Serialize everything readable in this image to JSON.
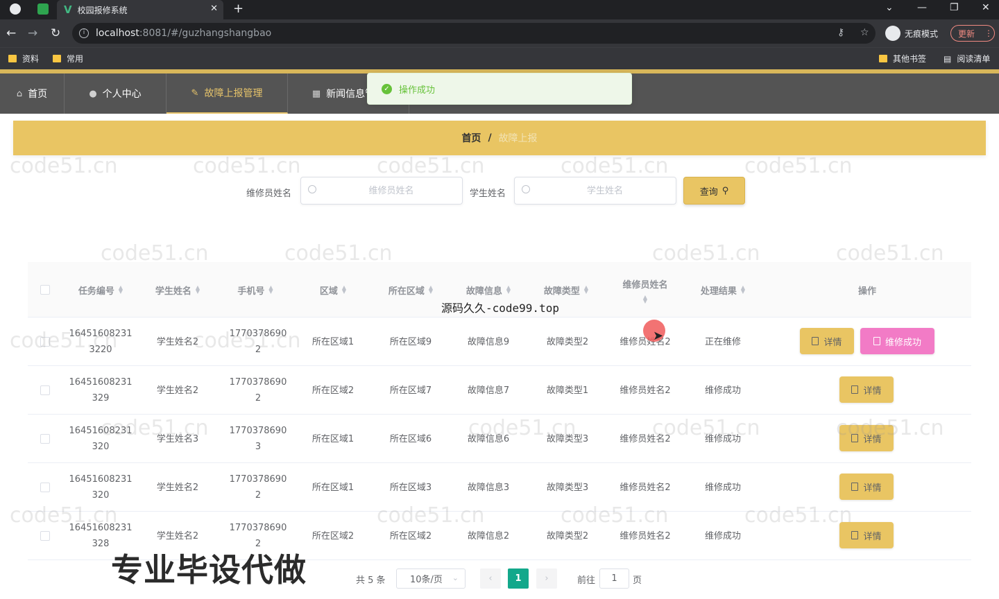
{
  "browser": {
    "tab_title": "校园报修系统",
    "tab_logo": "V",
    "url_host": "localhost",
    "url_path": ":8081/#/guzhangshangbao",
    "incognito_label": "无痕模式",
    "update_label": "更新",
    "bookmarks": [
      "资料",
      "常用"
    ],
    "other_bookmarks": "其他书签",
    "reading_list": "阅读清单"
  },
  "nav": {
    "items": [
      {
        "label": "首页",
        "icon": "home-icon"
      },
      {
        "label": "个人中心",
        "icon": "user-icon"
      },
      {
        "label": "故障上报管理",
        "icon": "edit-icon",
        "active": true
      },
      {
        "label": "新闻信息管理",
        "icon": "news-icon"
      }
    ]
  },
  "toast": {
    "message": "操作成功",
    "color": "#67c23a"
  },
  "breadcrumb": {
    "home": "首页",
    "separator": "/",
    "current": "故障上报"
  },
  "search": {
    "repairer_label": "维修员姓名",
    "repairer_placeholder": "维修员姓名",
    "student_label": "学生姓名",
    "student_placeholder": "学生姓名",
    "query_button": "查询"
  },
  "table": {
    "columns": [
      "任务编号",
      "学生姓名",
      "手机号",
      "区域",
      "所在区域",
      "故障信息",
      "故障类型",
      "维修员姓名",
      "处理结果",
      "操作"
    ],
    "rows": [
      {
        "task_no_1": "16451608231",
        "task_no_2": "3220",
        "student": "学生姓名2",
        "phone_1": "1770378690",
        "phone_2": "2",
        "area": "所在区域1",
        "location": "所在区域9",
        "fault_info": "故障信息9",
        "fault_type": "故障类型2",
        "repairer": "维修员姓名2",
        "result": "正在维修",
        "actions": [
          "详情",
          "维修成功"
        ]
      },
      {
        "task_no_1": "16451608231",
        "task_no_2": "329",
        "student": "学生姓名2",
        "phone_1": "1770378690",
        "phone_2": "2",
        "area": "所在区域2",
        "location": "所在区域7",
        "fault_info": "故障信息7",
        "fault_type": "故障类型1",
        "repairer": "维修员姓名2",
        "result": "维修成功",
        "actions": [
          "详情"
        ]
      },
      {
        "task_no_1": "16451608231",
        "task_no_2": "320",
        "student": "学生姓名3",
        "phone_1": "1770378690",
        "phone_2": "3",
        "area": "所在区域1",
        "location": "所在区域6",
        "fault_info": "故障信息6",
        "fault_type": "故障类型3",
        "repairer": "维修员姓名2",
        "result": "维修成功",
        "actions": [
          "详情"
        ]
      },
      {
        "task_no_1": "16451608231",
        "task_no_2": "320",
        "student": "学生姓名2",
        "phone_1": "1770378690",
        "phone_2": "2",
        "area": "所在区域1",
        "location": "所在区域3",
        "fault_info": "故障信息3",
        "fault_type": "故障类型3",
        "repairer": "维修员姓名2",
        "result": "维修成功",
        "actions": [
          "详情"
        ]
      },
      {
        "task_no_1": "16451608231",
        "task_no_2": "328",
        "student": "学生姓名2",
        "phone_1": "1770378690",
        "phone_2": "2",
        "area": "所在区域2",
        "location": "所在区域2",
        "fault_info": "故障信息2",
        "fault_type": "故障类型2",
        "repairer": "维修员姓名2",
        "result": "维修成功",
        "actions": [
          "详情"
        ]
      }
    ]
  },
  "pagination": {
    "total_text": "共 5 条",
    "page_size": "10条/页",
    "prev": "‹",
    "current_page": "1",
    "next": "›",
    "goto_label": "前往",
    "goto_value": "1",
    "page_suffix": "页"
  },
  "overlays": {
    "center_text": "源码久久-code99.top",
    "bottom_text": "专业毕设代做",
    "watermark": "code51.cn"
  },
  "colors": {
    "accent": "#e9c563",
    "nav_bg": "#545454",
    "repair_button": "#f27bc6",
    "pager_active": "#13a88b"
  }
}
